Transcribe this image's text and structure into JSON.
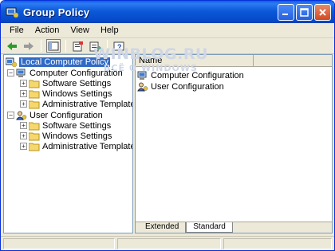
{
  "window": {
    "title": "Group Policy"
  },
  "menu": [
    "File",
    "Action",
    "View",
    "Help"
  ],
  "watermark": {
    "line1": "WINBLOG.RU",
    "line2": "ВСЁ О WINDOWS"
  },
  "tree": {
    "root": "Local Computer Policy",
    "computer": {
      "label": "Computer Configuration",
      "children": [
        "Software Settings",
        "Windows Settings",
        "Administrative Templates"
      ]
    },
    "user": {
      "label": "User Configuration",
      "children": [
        "Software Settings",
        "Windows Settings",
        "Administrative Templates"
      ]
    }
  },
  "list": {
    "column": "Name",
    "items": [
      "Computer Configuration",
      "User Configuration"
    ]
  },
  "tabs": [
    "Extended",
    "Standard"
  ],
  "colors": {
    "title_bar": "#0a5fe0",
    "selection": "#316ac5",
    "folder": "#f5d76e"
  }
}
